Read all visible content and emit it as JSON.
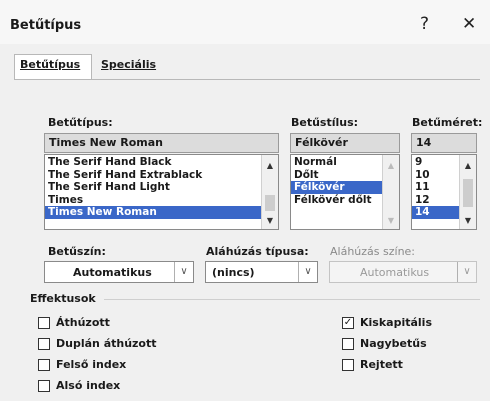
{
  "dialog": {
    "title": "Betűtípus",
    "help": "?",
    "close": "✕"
  },
  "tabs": [
    {
      "label": "Betűtípus"
    },
    {
      "label": "Speciális"
    }
  ],
  "font": {
    "label": "Betűtípus:",
    "value": "Times New Roman",
    "items": [
      "The Serif Hand Black",
      "The Serif Hand Extrablack",
      "The Serif Hand Light",
      "Times",
      "Times New Roman"
    ],
    "selected": "Times New Roman"
  },
  "style": {
    "label": "Betűstílus:",
    "value": "Félkövér",
    "items": [
      "Normál",
      "Dőlt",
      "Félkövér",
      "Félkövér dőlt"
    ],
    "selected": "Félkövér"
  },
  "size": {
    "label": "Betűméret:",
    "value": "14",
    "items": [
      "9",
      "10",
      "11",
      "12",
      "14"
    ],
    "selected": "14"
  },
  "color": {
    "label": "Betűszín:",
    "value": "Automatikus"
  },
  "underline": {
    "label": "Aláhúzás típusa:",
    "value": "(nincs)"
  },
  "underline_color": {
    "label": "Aláhúzás színe:",
    "value": "Automatikus"
  },
  "effects": {
    "heading": "Effektusok",
    "items": {
      "strike": {
        "label": "Áthúzott",
        "checked": false
      },
      "dstrike": {
        "label": "Duplán áthúzott",
        "checked": false
      },
      "sup": {
        "label": "Felső index",
        "checked": false
      },
      "sub": {
        "label": "Alsó index",
        "checked": false
      },
      "smallcaps": {
        "label": "Kiskapitális",
        "checked": true
      },
      "allcaps": {
        "label": "Nagybetűs",
        "checked": false
      },
      "hidden": {
        "label": "Rejtett",
        "checked": false
      }
    }
  },
  "icons": {
    "up": "▲",
    "down": "▼",
    "combo": "∨",
    "check": "✓"
  }
}
